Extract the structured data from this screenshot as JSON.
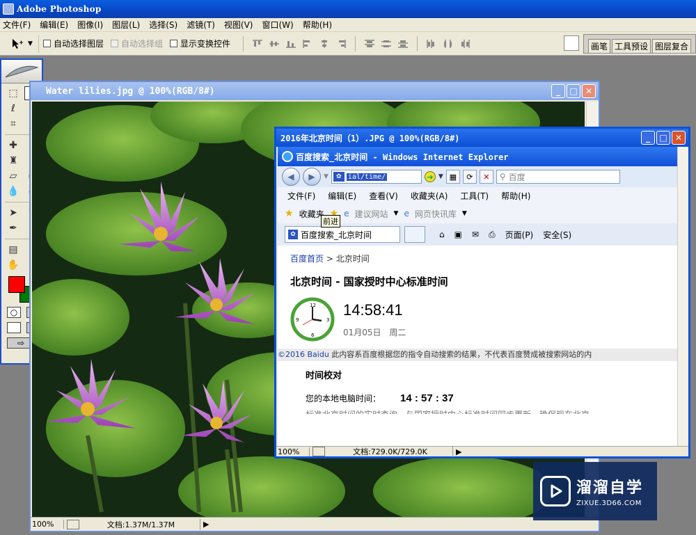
{
  "ps": {
    "title": "Adobe Photoshop",
    "menu": [
      "文件(F)",
      "编辑(E)",
      "图像(I)",
      "图层(L)",
      "选择(S)",
      "滤镜(T)",
      "视图(V)",
      "窗口(W)",
      "帮助(H)"
    ],
    "options": {
      "auto_select_layer": "自动选择图层",
      "auto_select_group": "自动选择组",
      "show_transform": "显示变换控件"
    },
    "palette_tabs": [
      "画笔",
      "工具预设",
      "图层复合"
    ],
    "colors": {
      "foreground": "#ff0000",
      "background": "#007a00"
    }
  },
  "doc_lily": {
    "title": "Water lilies.jpg @ 100%(RGB/8#)",
    "zoom": "100%",
    "info": "文档:1.37M/1.37M"
  },
  "doc_shot": {
    "title": "2016年北京时间（1）.JPG @ 100%(RGB/8#)",
    "zoom": "100%",
    "info": "文档:729.0K/729.0K"
  },
  "ie": {
    "title": "百度搜索_北京时间 - Windows Internet Explorer",
    "address": "ial/time/",
    "search_placeholder": "百度",
    "menu": [
      "文件(F)",
      "编辑(E)",
      "查看(V)",
      "收藏夹(A)",
      "工具(T)",
      "帮助(H)"
    ],
    "tooltip": "前进",
    "fav_label": "收藏夹",
    "fav_links": [
      "建议网站",
      "网页快讯库"
    ],
    "tab_label": "百度搜索_北京时间",
    "cmd_page": "页面(P)",
    "cmd_safety": "安全(S)",
    "breadcrumb_home": "百度首页",
    "breadcrumb_sep": ">",
    "breadcrumb_current": "北京时间",
    "heading": "北京时间 - 国家授时中心标准时间",
    "time": "14:58:41",
    "date": "01月05日",
    "weekday": "周二",
    "copyright_brand": "©2016 Baidu",
    "copyright_text": "此内容系百度根据您的指令自动搜索的结果，不代表百度赞成被搜索网站的内",
    "calib_title": "时间校对",
    "local_label": "您的本地电脑时间：",
    "local_time": "14 : 57 : 37",
    "cut_text": "标准北京时间的实时查询，与国家授时中心标准时间同步更新，确保现在北京"
  },
  "watermark": {
    "title": "溜溜自学",
    "sub": "ZIXUE.3D66.COM"
  }
}
